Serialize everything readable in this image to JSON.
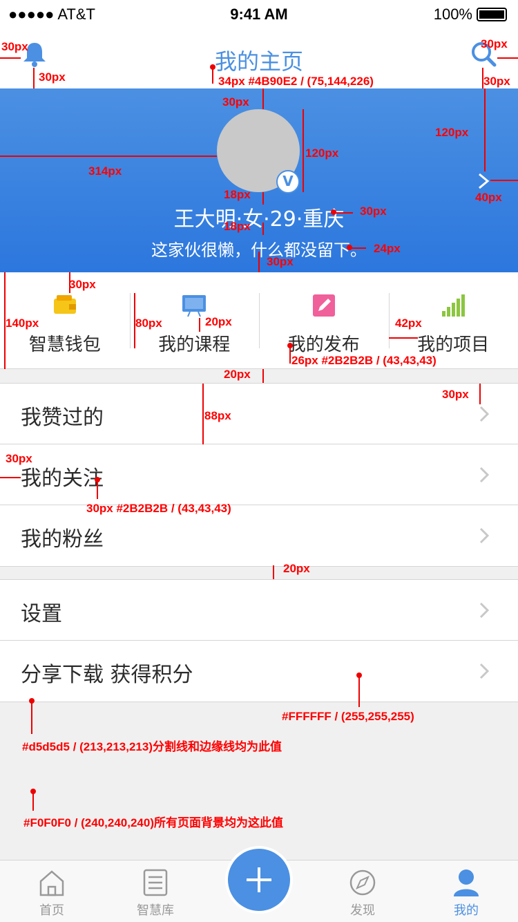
{
  "status_bar": {
    "carrier": "●●●●● AT&T",
    "time": "9:41 AM",
    "battery": "100%"
  },
  "header": {
    "title": "我的主页"
  },
  "profile": {
    "name": "王大明·女·29·重庆",
    "signature": "这家伙很懒，什么都没留下。",
    "badge": "V"
  },
  "actions": [
    {
      "label": "智慧钱包",
      "icon": "wallet-icon"
    },
    {
      "label": "我的课程",
      "icon": "course-icon"
    },
    {
      "label": "我的发布",
      "icon": "edit-icon"
    },
    {
      "label": "我的项目",
      "icon": "chart-icon"
    }
  ],
  "list1": [
    {
      "label": "我赞过的"
    },
    {
      "label": "我的关注"
    },
    {
      "label": "我的粉丝"
    }
  ],
  "list2": [
    {
      "label": "设置"
    },
    {
      "label": "分享下载 获得积分"
    }
  ],
  "tabs": [
    {
      "label": "首页",
      "icon": "home-icon"
    },
    {
      "label": "智慧库",
      "icon": "list-icon"
    },
    {
      "label": "发现",
      "icon": "compass-icon"
    },
    {
      "label": "我的",
      "icon": "user-icon"
    }
  ],
  "annotations": {
    "a1": "30px",
    "a2": "30px",
    "a3": "34px #4B90E2 / (75,144,226)",
    "a4": "30px",
    "a5": "30px",
    "a6": "30px",
    "a7": "120px",
    "a8": "314px",
    "a9": "120px",
    "a10": "18px",
    "a11": "30px",
    "a12": "18px",
    "a13": "24px",
    "a14": "30px",
    "a15": "40px",
    "a16": "30px",
    "a17": "140px",
    "a18": "80px",
    "a19": "20px",
    "a20": "42px",
    "a21": "26px #2B2B2B / (43,43,43)",
    "a22": "20px",
    "a23": "30px",
    "a24": "88px",
    "a25": "30px",
    "a26": "30px #2B2B2B / (43,43,43)",
    "a27": "20px",
    "a28": "#FFFFFF / (255,255,255)",
    "a29": "#d5d5d5 / (213,213,213)分割线和边缘线均为此值",
    "a30": "#F0F0F0 / (240,240,240)所有页面背景均为这此值"
  },
  "colors": {
    "accent": "#4B90E2",
    "text": "#2B2B2B",
    "divider": "#d5d5d5",
    "background": "#F0F0F0"
  }
}
